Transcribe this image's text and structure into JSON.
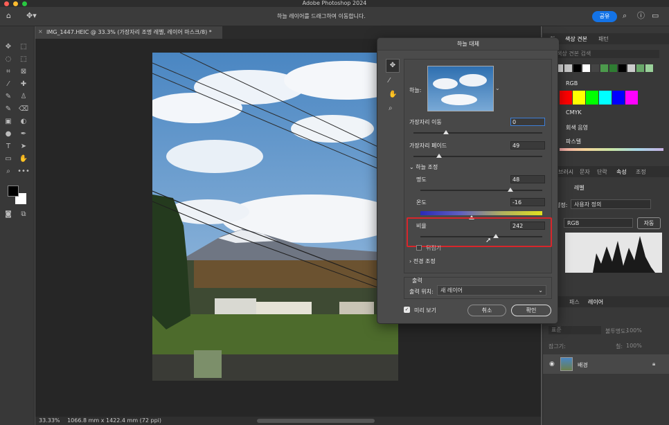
{
  "app": {
    "title": "Adobe Photoshop 2024",
    "hint": "하늘 레이어를 드래그하여 이동합니다.",
    "share": "공유"
  },
  "doc": {
    "tab_title": "IMG_1447.HEIC @ 33.3% (가장자리 조명 레벨, 레이어 마스크/8) *",
    "zoom": "33.33%",
    "dims": "1066.8 mm x 1422.4 mm (72 ppi)"
  },
  "dialog": {
    "title": "하늘 대체",
    "sky_label": "하늘:",
    "shift_edge_label": "가장자리 이동",
    "shift_edge_value": "0",
    "fade_edge_label": "가장자리 페이드",
    "fade_edge_value": "49",
    "sky_adjust_label": "하늘 조정",
    "brightness_label": "명도",
    "brightness_value": "48",
    "temperature_label": "온도",
    "temperature_value": "-16",
    "scale_label": "비율",
    "scale_value": "242",
    "flip_label": "뒤집기",
    "foreground_label": "전경 조정",
    "output_label": "출력",
    "output_to_label": "출력 위치:",
    "output_to_value": "새 레이어",
    "preview_label": "미리 보기",
    "cancel": "취소",
    "ok": "확인",
    "levels": {
      "shift_edge": 0.25,
      "fade_edge": 0.2,
      "brightness": 0.74,
      "temperature": 0.42,
      "scale": 0.62
    }
  },
  "right": {
    "tabs_top": [
      "히",
      "색상 견본",
      "패턴"
    ],
    "swatch_search": "색상 견본 검색",
    "groups": [
      "RGB",
      "CMYK",
      "회색 음영",
      "파스텔"
    ],
    "swatch_row_top": [
      "#d9d9d9",
      "#c8c8c8",
      "#000000",
      "#ffffff",
      "#444444",
      "#4c9a4c",
      "#2e7d32",
      "#000000",
      "#cccccc",
      "#69a86a",
      "#9ad19a"
    ],
    "swatch_row_rgb": [
      "#ff0000",
      "#ffff00",
      "#00ff00",
      "#00ffff",
      "#0000ff",
      "#ff00ff"
    ],
    "tabs_mid": [
      "브러시",
      "문자",
      "단락",
      "속성",
      "조정"
    ],
    "prop_level": "레벨",
    "preset_label": "설정:",
    "preset_value": "사용자 정의",
    "channel": "RGB",
    "auto": "자동",
    "tabs_layers": [
      "패스",
      "레이어"
    ],
    "layer_mode": "표준",
    "opacity_label": "불투명도:",
    "opacity": "100%",
    "lock_label": "잠그기:",
    "fill_label": "칠:",
    "fill": "100%",
    "layer_name": "배경"
  }
}
